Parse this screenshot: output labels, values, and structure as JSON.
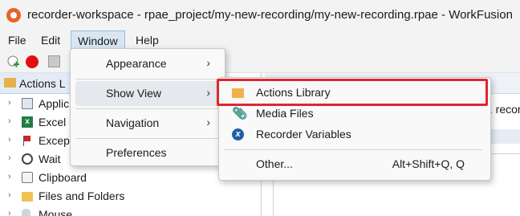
{
  "window": {
    "title": "recorder-workspace - rpae_project/my-new-recording/my-new-recording.rpae - WorkFusion"
  },
  "menubar": {
    "items": [
      "File",
      "Edit",
      "Window",
      "Help"
    ]
  },
  "left_panel": {
    "tab_label": "Actions L",
    "tree": [
      {
        "label": "Applic",
        "icon": "application-icon"
      },
      {
        "label": "Excel",
        "icon": "excel-icon"
      },
      {
        "label": "Excep",
        "icon": "flag-icon"
      },
      {
        "label": "Wait",
        "icon": "clock-icon"
      },
      {
        "label": "Clipboard",
        "icon": "clipboard-icon"
      },
      {
        "label": "Files and Folders",
        "icon": "folder-icon"
      },
      {
        "label": "Mouse",
        "icon": "mouse-icon"
      }
    ]
  },
  "right_area": {
    "clipped_text": "t. recor"
  },
  "window_menu": {
    "items": [
      {
        "label": "Appearance",
        "submenu": true
      },
      {
        "label": "Show View",
        "submenu": true
      },
      {
        "label": "Navigation",
        "submenu": true
      },
      {
        "label": "Preferences",
        "submenu": false
      }
    ]
  },
  "show_view_menu": {
    "items": [
      {
        "label": "Actions Library",
        "icon": "folder-icon",
        "accel": ""
      },
      {
        "label": "Media Files",
        "icon": "paperclip-icon",
        "accel": ""
      },
      {
        "label": "Recorder Variables",
        "icon": "variable-icon",
        "accel": ""
      },
      {
        "label": "Other...",
        "icon": "",
        "accel": "Alt+Shift+Q, Q"
      }
    ],
    "highlighted": "Actions Library"
  },
  "icons": {
    "submenu_arrow": "›",
    "tree_chevron": "›",
    "variable_glyph": "x"
  },
  "colors": {
    "highlight": "#e0262e",
    "record": "#e01010",
    "menu_bg": "#f9f9f9"
  }
}
